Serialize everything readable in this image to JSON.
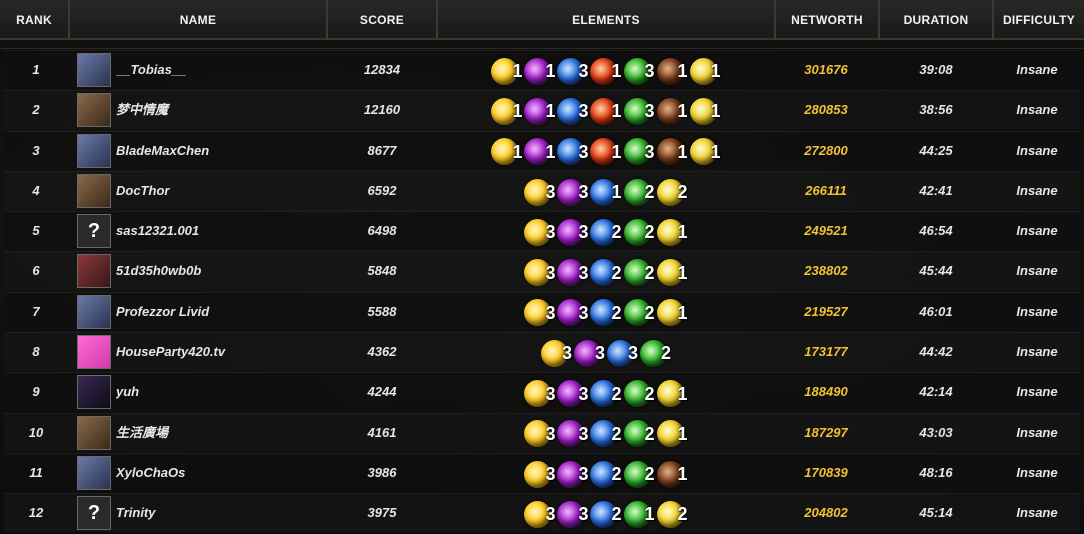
{
  "header": {
    "rank": "RANK",
    "name": "NAME",
    "score": "SCORE",
    "elements": "ELEMENTS",
    "networth": "NETWORTH",
    "duration": "DURATION",
    "difficulty": "DIFFICULTY"
  },
  "colors": {
    "networth": "#f1c232",
    "header_bg": "#2a2826",
    "row_bg": "#101010"
  },
  "element_icons": {
    "light": "light-orb-icon",
    "void": "void-orb-icon",
    "water": "water-orb-icon",
    "fire": "fire-orb-icon",
    "nature": "nature-orb-icon",
    "earth": "earth-orb-icon",
    "arcane": "arcane-orb-icon"
  },
  "rows": [
    {
      "rank": "1",
      "name": "__Tobias__",
      "avatar": "image",
      "score": "12834",
      "elements": [
        {
          "type": "light",
          "count": "1"
        },
        {
          "type": "void",
          "count": "1"
        },
        {
          "type": "water",
          "count": "3"
        },
        {
          "type": "fire",
          "count": "1"
        },
        {
          "type": "nature",
          "count": "3"
        },
        {
          "type": "earth",
          "count": "1"
        },
        {
          "type": "arcane",
          "count": "1"
        }
      ],
      "networth": "301676",
      "duration": "39:08",
      "difficulty": "Insane"
    },
    {
      "rank": "2",
      "name": "梦中情魔",
      "avatar": "image",
      "score": "12160",
      "elements": [
        {
          "type": "light",
          "count": "1"
        },
        {
          "type": "void",
          "count": "1"
        },
        {
          "type": "water",
          "count": "3"
        },
        {
          "type": "fire",
          "count": "1"
        },
        {
          "type": "nature",
          "count": "3"
        },
        {
          "type": "earth",
          "count": "1"
        },
        {
          "type": "arcane",
          "count": "1"
        }
      ],
      "networth": "280853",
      "duration": "38:56",
      "difficulty": "Insane"
    },
    {
      "rank": "3",
      "name": "BladeMaxChen",
      "avatar": "image",
      "score": "8677",
      "elements": [
        {
          "type": "light",
          "count": "1"
        },
        {
          "type": "void",
          "count": "1"
        },
        {
          "type": "water",
          "count": "3"
        },
        {
          "type": "fire",
          "count": "1"
        },
        {
          "type": "nature",
          "count": "3"
        },
        {
          "type": "earth",
          "count": "1"
        },
        {
          "type": "arcane",
          "count": "1"
        }
      ],
      "networth": "272800",
      "duration": "44:25",
      "difficulty": "Insane"
    },
    {
      "rank": "4",
      "name": "DocThor",
      "avatar": "image",
      "score": "6592",
      "elements": [
        {
          "type": "light",
          "count": "3"
        },
        {
          "type": "void",
          "count": "3"
        },
        {
          "type": "water",
          "count": "1"
        },
        {
          "type": "nature",
          "count": "2"
        },
        {
          "type": "arcane",
          "count": "2"
        }
      ],
      "networth": "266111",
      "duration": "42:41",
      "difficulty": "Insane"
    },
    {
      "rank": "5",
      "name": "sas12321.001",
      "avatar": "?",
      "score": "6498",
      "elements": [
        {
          "type": "light",
          "count": "3"
        },
        {
          "type": "void",
          "count": "3"
        },
        {
          "type": "water",
          "count": "2"
        },
        {
          "type": "nature",
          "count": "2"
        },
        {
          "type": "arcane",
          "count": "1"
        }
      ],
      "networth": "249521",
      "duration": "46:54",
      "difficulty": "Insane"
    },
    {
      "rank": "6",
      "name": "51d35h0wb0b",
      "avatar": "image",
      "score": "5848",
      "elements": [
        {
          "type": "light",
          "count": "3"
        },
        {
          "type": "void",
          "count": "3"
        },
        {
          "type": "water",
          "count": "2"
        },
        {
          "type": "nature",
          "count": "2"
        },
        {
          "type": "arcane",
          "count": "1"
        }
      ],
      "networth": "238802",
      "duration": "45:44",
      "difficulty": "Insane"
    },
    {
      "rank": "7",
      "name": "Profezzor Livid",
      "avatar": "image",
      "score": "5588",
      "elements": [
        {
          "type": "light",
          "count": "3"
        },
        {
          "type": "void",
          "count": "3"
        },
        {
          "type": "water",
          "count": "2"
        },
        {
          "type": "nature",
          "count": "2"
        },
        {
          "type": "arcane",
          "count": "1"
        }
      ],
      "networth": "219527",
      "duration": "46:01",
      "difficulty": "Insane"
    },
    {
      "rank": "8",
      "name": "HouseParty420.tv",
      "avatar": "image",
      "score": "4362",
      "elements": [
        {
          "type": "light",
          "count": "3"
        },
        {
          "type": "void",
          "count": "3"
        },
        {
          "type": "water",
          "count": "3"
        },
        {
          "type": "nature",
          "count": "2"
        }
      ],
      "networth": "173177",
      "duration": "44:42",
      "difficulty": "Insane"
    },
    {
      "rank": "9",
      "name": "yuh",
      "avatar": "image",
      "score": "4244",
      "elements": [
        {
          "type": "light",
          "count": "3"
        },
        {
          "type": "void",
          "count": "3"
        },
        {
          "type": "water",
          "count": "2"
        },
        {
          "type": "nature",
          "count": "2"
        },
        {
          "type": "arcane",
          "count": "1"
        }
      ],
      "networth": "188490",
      "duration": "42:14",
      "difficulty": "Insane"
    },
    {
      "rank": "10",
      "name": "生活廣場",
      "avatar": "image",
      "score": "4161",
      "elements": [
        {
          "type": "light",
          "count": "3"
        },
        {
          "type": "void",
          "count": "3"
        },
        {
          "type": "water",
          "count": "2"
        },
        {
          "type": "nature",
          "count": "2"
        },
        {
          "type": "arcane",
          "count": "1"
        }
      ],
      "networth": "187297",
      "duration": "43:03",
      "difficulty": "Insane"
    },
    {
      "rank": "11",
      "name": "XyloChaOs",
      "avatar": "image",
      "score": "3986",
      "elements": [
        {
          "type": "light",
          "count": "3"
        },
        {
          "type": "void",
          "count": "3"
        },
        {
          "type": "water",
          "count": "2"
        },
        {
          "type": "nature",
          "count": "2"
        },
        {
          "type": "earth",
          "count": "1"
        }
      ],
      "networth": "170839",
      "duration": "48:16",
      "difficulty": "Insane"
    },
    {
      "rank": "12",
      "name": "Trinity",
      "avatar": "?",
      "score": "3975",
      "elements": [
        {
          "type": "light",
          "count": "3"
        },
        {
          "type": "void",
          "count": "3"
        },
        {
          "type": "water",
          "count": "2"
        },
        {
          "type": "nature",
          "count": "1"
        },
        {
          "type": "arcane",
          "count": "2"
        }
      ],
      "networth": "204802",
      "duration": "45:14",
      "difficulty": "Insane"
    }
  ]
}
